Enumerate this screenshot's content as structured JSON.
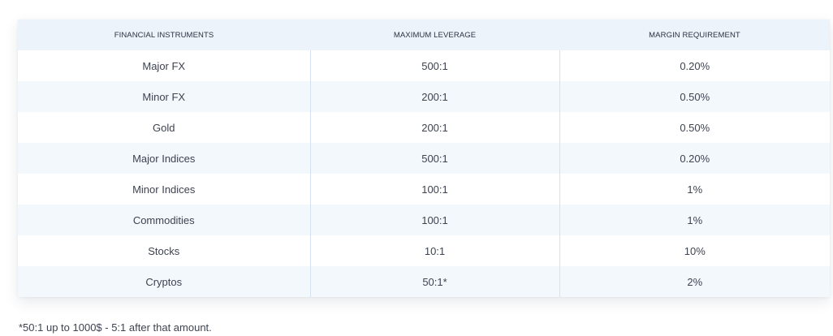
{
  "table": {
    "headers": [
      "FINANCIAL INSTRUMENTS",
      "MAXIMUM LEVERAGE",
      "MARGIN REQUIREMENT"
    ],
    "rows": [
      [
        "Major FX",
        "500:1",
        "0.20%"
      ],
      [
        "Minor FX",
        "200:1",
        "0.50%"
      ],
      [
        "Gold",
        "200:1",
        "0.50%"
      ],
      [
        "Major Indices",
        "500:1",
        "0.20%"
      ],
      [
        "Minor Indices",
        "100:1",
        "1%"
      ],
      [
        "Commodities",
        "100:1",
        "1%"
      ],
      [
        "Stocks",
        "10:1",
        "10%"
      ],
      [
        "Cryptos",
        "50:1*",
        "2%"
      ]
    ]
  },
  "footnote": "*50:1 up to 1000$ - 5:1 after that amount."
}
